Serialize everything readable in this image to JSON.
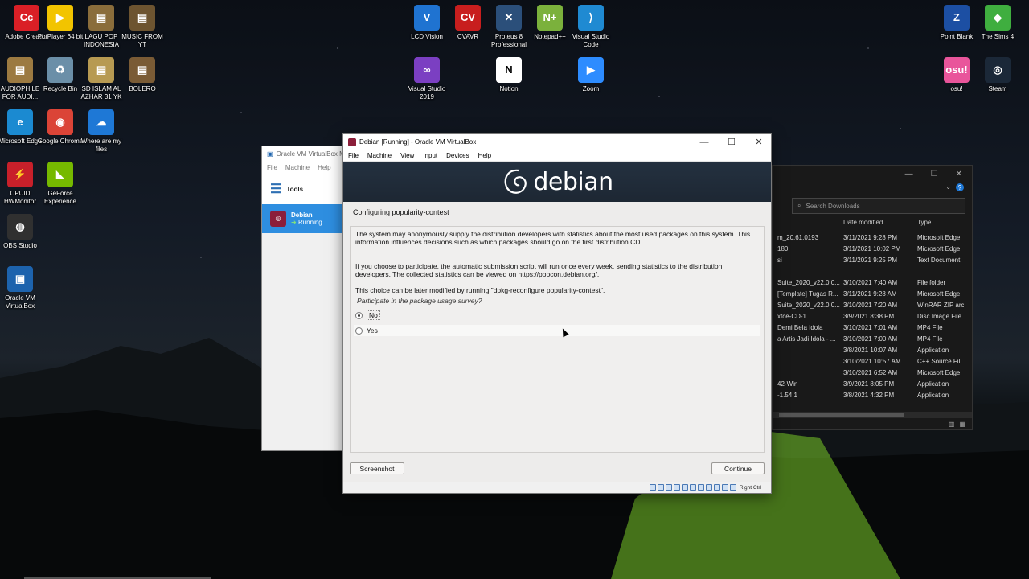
{
  "desktop": {
    "icons_left": [
      {
        "label": "Adobe Creati...",
        "icon": "adobe-cc-icon",
        "color": "#da1f26",
        "glyph": "Cc"
      },
      {
        "label": "PotPlayer 64 bit",
        "icon": "potplayer-icon",
        "color": "#f2c400",
        "glyph": "▶"
      },
      {
        "label": "LAGU POP INDONESIA",
        "icon": "archive-icon",
        "color": "#8a6d3b",
        "glyph": "▤"
      },
      {
        "label": "MUSIC FROM YT",
        "icon": "archive-icon",
        "color": "#6d5430",
        "glyph": "▤"
      },
      {
        "label": "AUDIOPHILE FOR AUDI...",
        "icon": "archive-icon",
        "color": "#9c7a41",
        "glyph": "▤"
      },
      {
        "label": "Recycle Bin",
        "icon": "recycle-bin-icon",
        "color": "#6b8fa8",
        "glyph": "♻"
      },
      {
        "label": "SD ISLAM AL AZHAR 31 YK",
        "icon": "archive-icon",
        "color": "#b79a52",
        "glyph": "▤"
      },
      {
        "label": "BOLERO",
        "icon": "archive-icon",
        "color": "#7a5b35",
        "glyph": "▤"
      },
      {
        "label": "Microsoft Edge",
        "icon": "edge-icon",
        "color": "#1b8ad1",
        "glyph": "e"
      },
      {
        "label": "Google Chrome",
        "icon": "chrome-icon",
        "color": "#db4437",
        "glyph": "◉"
      },
      {
        "label": "Where are my files",
        "icon": "onedrive-icon",
        "color": "#1e78d6",
        "glyph": "☁"
      },
      {
        "label": "CPUID HWMonitor",
        "icon": "hwmonitor-icon",
        "color": "#c8202a",
        "glyph": "⚡"
      },
      {
        "label": "GeForce Experience",
        "icon": "geforce-icon",
        "color": "#76b900",
        "glyph": "◣"
      },
      {
        "label": "OBS Studio",
        "icon": "obs-icon",
        "color": "#303030",
        "glyph": "◍"
      },
      {
        "label": "Oracle VM VirtualBox",
        "icon": "virtualbox-icon",
        "color": "#1d63ad",
        "glyph": "▣"
      }
    ],
    "icons_top": [
      {
        "label": "LCD Vision",
        "icon": "lcd-vision-icon",
        "color": "#1f73d1",
        "glyph": "V"
      },
      {
        "label": "CVAVR",
        "icon": "cvavr-icon",
        "color": "#c81e1e",
        "glyph": "CV"
      },
      {
        "label": "Proteus 8 Professional",
        "icon": "proteus-icon",
        "color": "#2b4f7a",
        "glyph": "✕"
      },
      {
        "label": "Notepad++",
        "icon": "notepadpp-icon",
        "color": "#7bb13c",
        "glyph": "N+"
      },
      {
        "label": "Visual Studio Code",
        "icon": "vscode-icon",
        "color": "#1f8ad2",
        "glyph": "⟩"
      },
      {
        "label": "Visual Studio 2019",
        "icon": "visual-studio-icon",
        "color": "#7b3fc2",
        "glyph": "∞"
      },
      {
        "label": "Notion",
        "icon": "notion-icon",
        "color": "#ffffff",
        "glyph": "N"
      },
      {
        "label": "Zoom",
        "icon": "zoom-icon",
        "color": "#2d8cff",
        "glyph": "▶"
      }
    ],
    "icons_right": [
      {
        "label": "Point Blank",
        "icon": "point-blank-icon",
        "color": "#1c4fa3",
        "glyph": "Z"
      },
      {
        "label": "The Sims 4",
        "icon": "sims-icon",
        "color": "#3fae3f",
        "glyph": "◆"
      },
      {
        "label": "osu!",
        "icon": "osu-icon",
        "color": "#e9559b",
        "glyph": "osu!"
      },
      {
        "label": "Steam",
        "icon": "steam-icon",
        "color": "#1b2838",
        "glyph": "◎"
      }
    ]
  },
  "vbox_manager": {
    "title": "Oracle VM VirtualBox M",
    "menu": [
      "File",
      "Machine",
      "Help"
    ],
    "tools_label": "Tools",
    "vm_name": "Debian",
    "vm_state": "Running"
  },
  "explorer": {
    "search_placeholder": "Search Downloads",
    "col_date": "Date modified",
    "col_type": "Type",
    "rows": [
      {
        "name": "m_20.61.0193",
        "date": "3/11/2021 9:28 PM",
        "type": "Microsoft Edge"
      },
      {
        "name": "180",
        "date": "3/11/2021 10:02 PM",
        "type": "Microsoft Edge"
      },
      {
        "name": "si",
        "date": "3/11/2021 9:25 PM",
        "type": "Text Document"
      },
      {
        "name": "",
        "date": "",
        "type": ""
      },
      {
        "name": "Suite_2020_v22.0.0...",
        "date": "3/10/2021 7:40 AM",
        "type": "File folder"
      },
      {
        "name": "[Template] Tugas R...",
        "date": "3/11/2021 9:28 AM",
        "type": "Microsoft Edge"
      },
      {
        "name": "Suite_2020_v22.0.0...",
        "date": "3/10/2021 7:20 AM",
        "type": "WinRAR ZIP arc"
      },
      {
        "name": "xfce-CD-1",
        "date": "3/9/2021 8:38 PM",
        "type": "Disc Image File"
      },
      {
        "name": "Demi Bela Idola_",
        "date": "3/10/2021 7:01 AM",
        "type": "MP4 File"
      },
      {
        "name": "a Artis Jadi Idola - ...",
        "date": "3/10/2021 7:00 AM",
        "type": "MP4 File"
      },
      {
        "name": "",
        "date": "3/8/2021 10:07 AM",
        "type": "Application"
      },
      {
        "name": "",
        "date": "3/10/2021 10:57 AM",
        "type": "C++ Source Fil"
      },
      {
        "name": "",
        "date": "3/10/2021 6:52 AM",
        "type": "Microsoft Edge"
      },
      {
        "name": "42-Win",
        "date": "3/9/2021 8:05 PM",
        "type": "Application"
      },
      {
        "name": "-1.54.1",
        "date": "3/8/2021 4:32 PM",
        "type": "Application"
      }
    ]
  },
  "vm_window": {
    "title": "Debian [Running] - Oracle VM VirtualBox",
    "menu": [
      "File",
      "Machine",
      "View",
      "Input",
      "Devices",
      "Help"
    ],
    "status_right": "Right Ctrl"
  },
  "installer": {
    "brand": "debian",
    "section_title": "Configuring popularity-contest",
    "para1": "The system may anonymously supply the distribution developers with statistics about the most used packages on this system. This information influences decisions such as which packages should go on the first distribution CD.",
    "para2": "If you choose to participate, the automatic submission script will run once every week, sending statistics to the distribution developers. The collected statistics can be viewed on https://popcon.debian.org/.",
    "para3": "This choice can be later modified by running \"dpkg-reconfigure popularity-contest\".",
    "question": "Participate in the package usage survey?",
    "option_no": "No",
    "option_yes": "Yes",
    "selected": "No",
    "screenshot_label": "Screenshot",
    "continue_label": "Continue"
  }
}
